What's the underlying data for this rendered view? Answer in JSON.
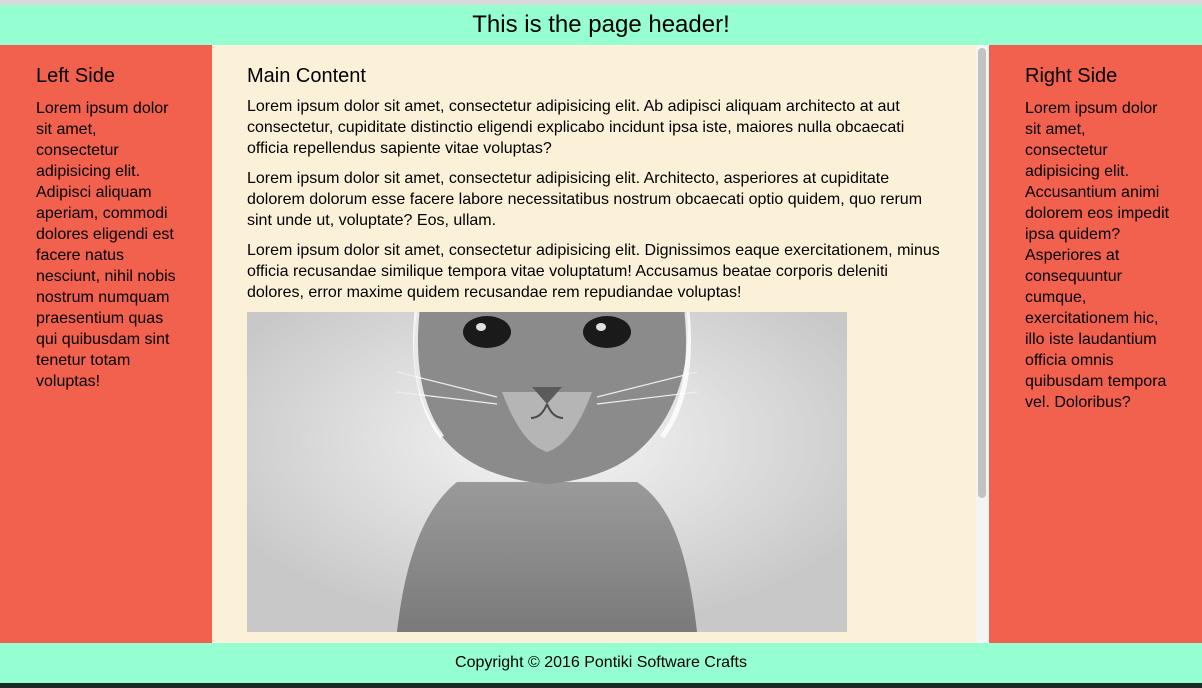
{
  "header": {
    "title": "This is the page header!"
  },
  "left": {
    "title": "Left Side",
    "text": "Lorem ipsum dolor sit amet, consectetur adipisicing elit. Adipisci aliquam aperiam, commodi dolores eligendi est facere natus nesciunt, nihil nobis nostrum numquam praesentium quas qui quibusdam sint tenetur totam voluptas!"
  },
  "main": {
    "title": "Main Content",
    "paragraphs": [
      "Lorem ipsum dolor sit amet, consectetur adipisicing elit. Ab adipisci aliquam architecto at aut consectetur, cupiditate distinctio eligendi explicabo incidunt ipsa iste, maiores nulla obcaecati officia repellendus sapiente vitae voluptas?",
      "Lorem ipsum dolor sit amet, consectetur adipisicing elit. Architecto, asperiores at cupiditate dolorem dolorum esse facere labore necessitatibus nostrum obcaecati optio quidem, quo rerum sint unde ut, voluptate? Eos, ullam.",
      "Lorem ipsum dolor sit amet, consectetur adipisicing elit. Dignissimos eaque exercitationem, minus officia recusandae similique tempora vitae voluptatum! Accusamus beatae corporis deleniti dolores, error maxime quidem recusandae rem repudiandae voluptas!"
    ]
  },
  "right": {
    "title": "Right Side",
    "text": "Lorem ipsum dolor sit amet, consectetur adipisicing elit. Accusantium animi dolorem eos impedit ipsa quidem? Asperiores at consequuntur cumque, exercitationem hic, illo iste laudantium officia omnis quibusdam tempora vel. Doloribus?"
  },
  "footer": {
    "copyright": "Copyright © 2016 Pontiki Software Crafts"
  },
  "colors": {
    "header_bg": "#95ffd2",
    "sidebar_bg": "#f2604e",
    "main_bg": "#fbf0d8"
  }
}
